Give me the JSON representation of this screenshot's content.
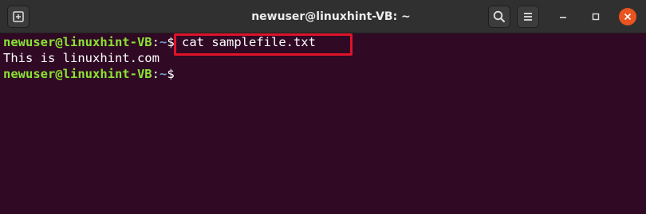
{
  "window": {
    "title": "newuser@linuxhint-VB: ~"
  },
  "icons": {
    "new_tab": "new-tab-icon",
    "search": "search-icon",
    "menu": "hamburger-menu-icon",
    "minimize": "minimize-icon",
    "maximize": "maximize-icon",
    "close": "close-icon"
  },
  "colors": {
    "terminal_bg": "#300a24",
    "prompt_user": "#8ae234",
    "prompt_path": "#729fcf",
    "highlight_box": "#e0132a",
    "close_button": "#e95420"
  },
  "terminal": {
    "line1": {
      "user_host": "newuser@linuxhint-VB",
      "colon": ":",
      "path": "~",
      "symbol": "$",
      "command": " cat samplefile.txt"
    },
    "line2": {
      "output": "This is linuxhint.com"
    },
    "line3": {
      "user_host": "newuser@linuxhint-VB",
      "colon": ":",
      "path": "~",
      "symbol": "$"
    }
  }
}
